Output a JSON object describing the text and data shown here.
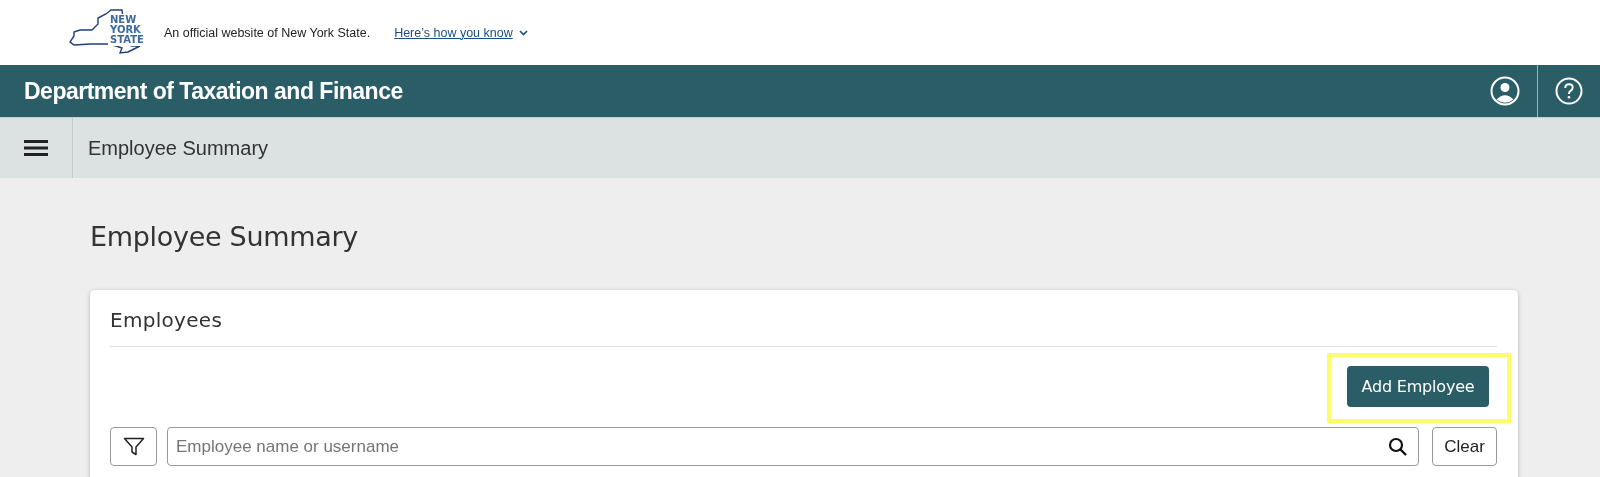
{
  "gov_banner": {
    "logo_text": "NEW YORK STATE",
    "statement": "An official website of New York State.",
    "link": "Here’s how you know"
  },
  "header": {
    "title": "Department of Taxation and Finance"
  },
  "nav": {
    "title": "Employee Summary"
  },
  "page": {
    "heading": "Employee Summary"
  },
  "card": {
    "title": "Employees",
    "add_button": {
      "label": "Add Employee",
      "highlighted": true
    },
    "search": {
      "placeholder": "Employee name or username"
    },
    "clear_button": "Clear"
  }
}
